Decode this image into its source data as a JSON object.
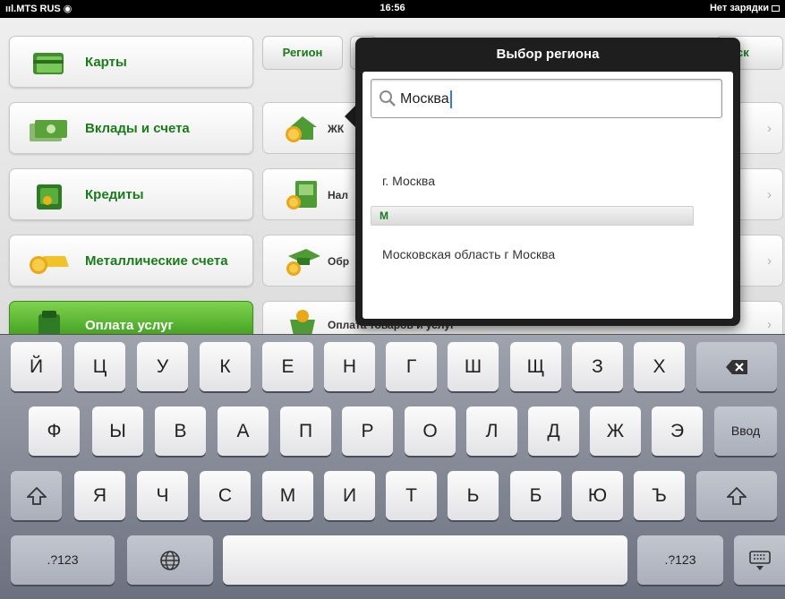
{
  "status_bar": {
    "carrier": "MTS RUS",
    "time": "16:56",
    "battery": "Нет зарядки"
  },
  "menu": {
    "items": [
      {
        "label": "Карты",
        "active": false
      },
      {
        "label": "Вклады и счета",
        "active": false
      },
      {
        "label": "Кредиты",
        "active": false
      },
      {
        "label": "Металлические счета",
        "active": false
      },
      {
        "label": "Оплата услуг",
        "active": true
      }
    ]
  },
  "top_bar": {
    "region_button": "Регион",
    "search_button_fragment": "иск"
  },
  "content_rows": [
    {
      "label": "ЖК"
    },
    {
      "label": "Нал"
    },
    {
      "label": "Обр"
    },
    {
      "label": "Оплата товаров и услуг"
    }
  ],
  "popover": {
    "title": "Выбор региона",
    "search_value": "Москва",
    "results": [
      {
        "text": "г. Москва"
      },
      {
        "text": "Московская область г Москва"
      }
    ],
    "section_header": "М",
    "index_letter": "М"
  },
  "keyboard": {
    "row1": [
      "Й",
      "Ц",
      "У",
      "К",
      "Е",
      "Н",
      "Г",
      "Ш",
      "Щ",
      "З",
      "Х"
    ],
    "row2": [
      "Ф",
      "Ы",
      "В",
      "А",
      "П",
      "Р",
      "О",
      "Л",
      "Д",
      "Ж",
      "Э"
    ],
    "row3": [
      "Я",
      "Ч",
      "С",
      "М",
      "И",
      "Т",
      "Ь",
      "Б",
      "Ю",
      "Ъ"
    ],
    "enter_label": "Ввод",
    "numbers_label": ".?123",
    "numbers_label_right": ".?123"
  },
  "colors": {
    "brand_green": "#1a7b1a",
    "active_green": "#4aa928",
    "popover_dark": "#1e1e1e"
  }
}
